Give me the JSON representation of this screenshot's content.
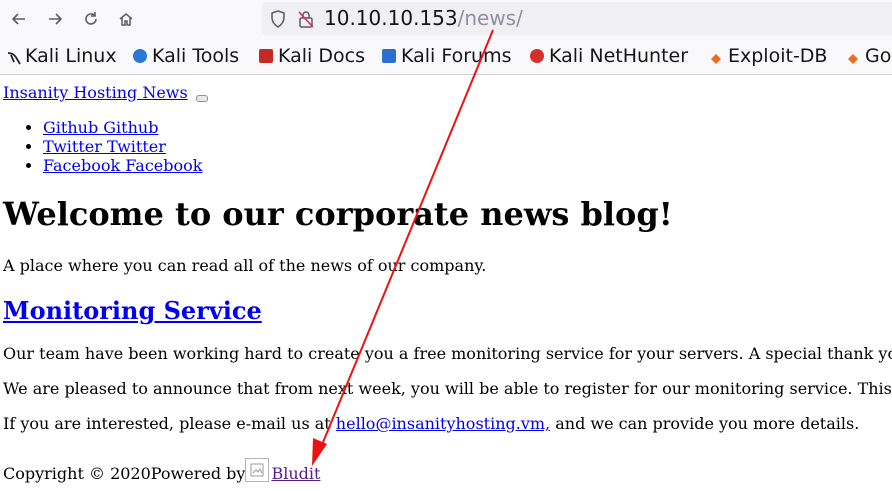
{
  "browser": {
    "url_host": "10.10.10.153",
    "url_path": "/news/",
    "bookmarks": [
      "Kali Linux",
      "Kali Tools",
      "Kali Docs",
      "Kali Forums",
      "Kali NetHunter",
      "Exploit-DB",
      "Go"
    ]
  },
  "page": {
    "site_title": "Insanity Hosting News",
    "social_links": [
      "Github Github",
      "Twitter Twitter",
      "Facebook Facebook"
    ],
    "heading": "Welcome to our corporate news blog!",
    "intro": "A place where you can read all of the news of our company.",
    "post_title": "Monitoring Service",
    "para1": "Our team have been working hard to create you a free monitoring service for your servers. A special thank you to our dev",
    "para2": "We are pleased to announce that from next week, you will be able to register for our monitoring service. This will be the",
    "para3_before": "If you are interested, please e-mail us at",
    "email": "hello@insanityhosting.vm,",
    "para3_after": "and we can provide you more details.",
    "footer_copyright": "Copyright © 2020Powered by",
    "footer_link": "Bludit"
  },
  "colors": {
    "link": "#0000ee",
    "visited": "#551a8b",
    "arrow": "#ee1111"
  }
}
